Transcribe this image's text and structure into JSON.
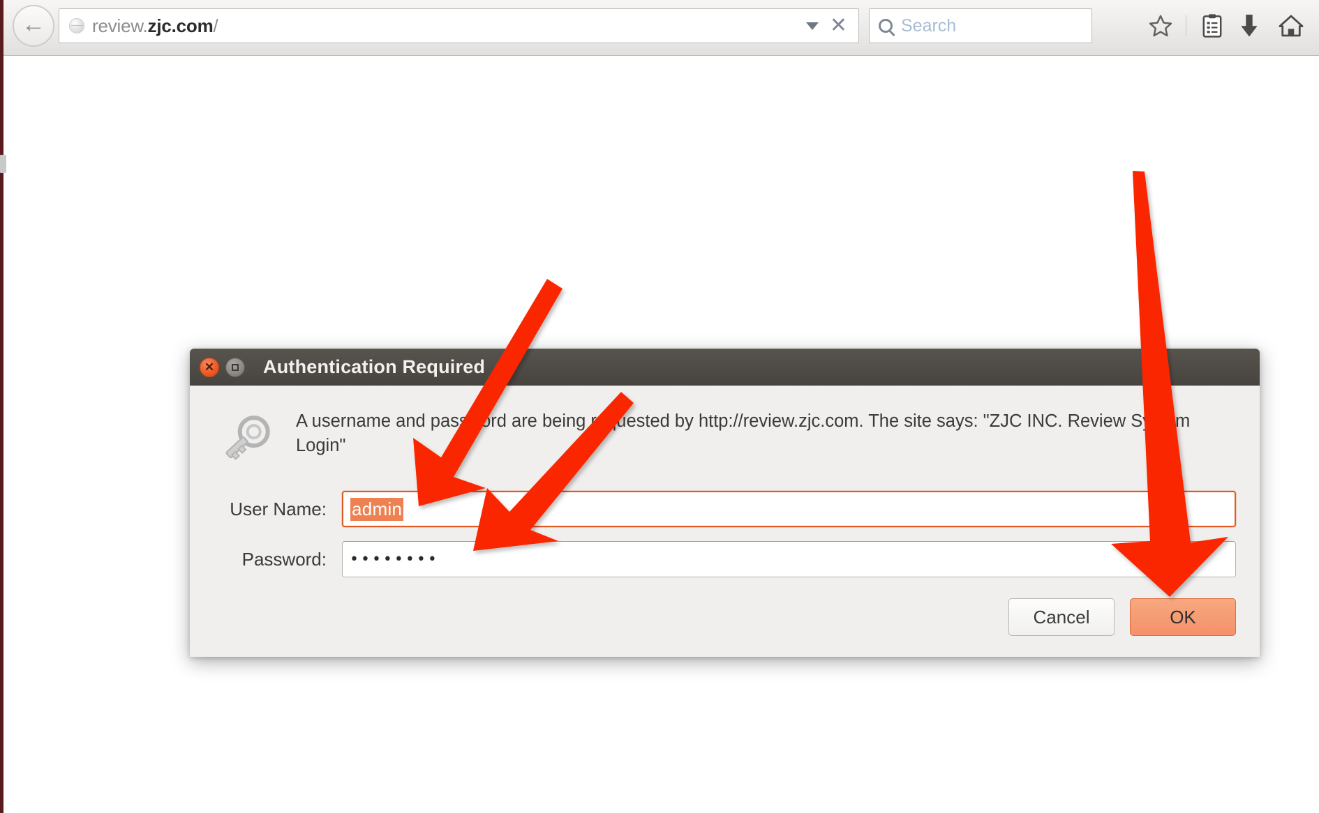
{
  "browser": {
    "back_button_icon": "back-arrow-icon",
    "url_bar": {
      "value": "review.zjc.com/",
      "host_bold": "zjc.com",
      "globe_icon": "globe-icon",
      "dropdown_icon": "chevron-down-icon",
      "stop_icon": "close-x-icon"
    },
    "search_bar": {
      "placeholder": "Search",
      "value": "",
      "icon": "search-icon"
    },
    "toolbar_icons": [
      {
        "name": "bookmark-star-icon",
        "label": "Bookmark"
      },
      {
        "name": "reading-list-icon",
        "label": "Reading List"
      },
      {
        "name": "downloads-icon",
        "label": "Downloads"
      },
      {
        "name": "home-icon",
        "label": "Home"
      }
    ]
  },
  "dialog": {
    "title": "Authentication Required",
    "close_button_label": "×",
    "maximize_button_label": "□",
    "key_icon": "key-icon",
    "message": "A username and password are being requested by http://review.zjc.com. The site says: \"ZJC INC. Review System Login\"",
    "fields": [
      {
        "label": "User Name:",
        "value": "admin",
        "type": "text",
        "focused": true,
        "selected": true
      },
      {
        "label": "Password:",
        "value": "••••••••",
        "type": "password",
        "focused": false,
        "selected": false
      }
    ],
    "buttons": {
      "cancel": "Cancel",
      "ok": "OK"
    }
  },
  "annotations": {
    "arrow_color": "#fa2600",
    "arrows": [
      {
        "name": "arrow-to-username-field",
        "target": "User Name field"
      },
      {
        "name": "arrow-to-password-field",
        "target": "Password field"
      },
      {
        "name": "arrow-to-ok-button",
        "target": "OK button"
      }
    ]
  },
  "colors": {
    "accent_orange": "#e05a22",
    "selection_orange": "#ee8152",
    "ok_button": "#f4916a",
    "titlebar": "#4c4944",
    "arrow_red": "#fa2600",
    "window_edge": "#5b1a1e"
  }
}
